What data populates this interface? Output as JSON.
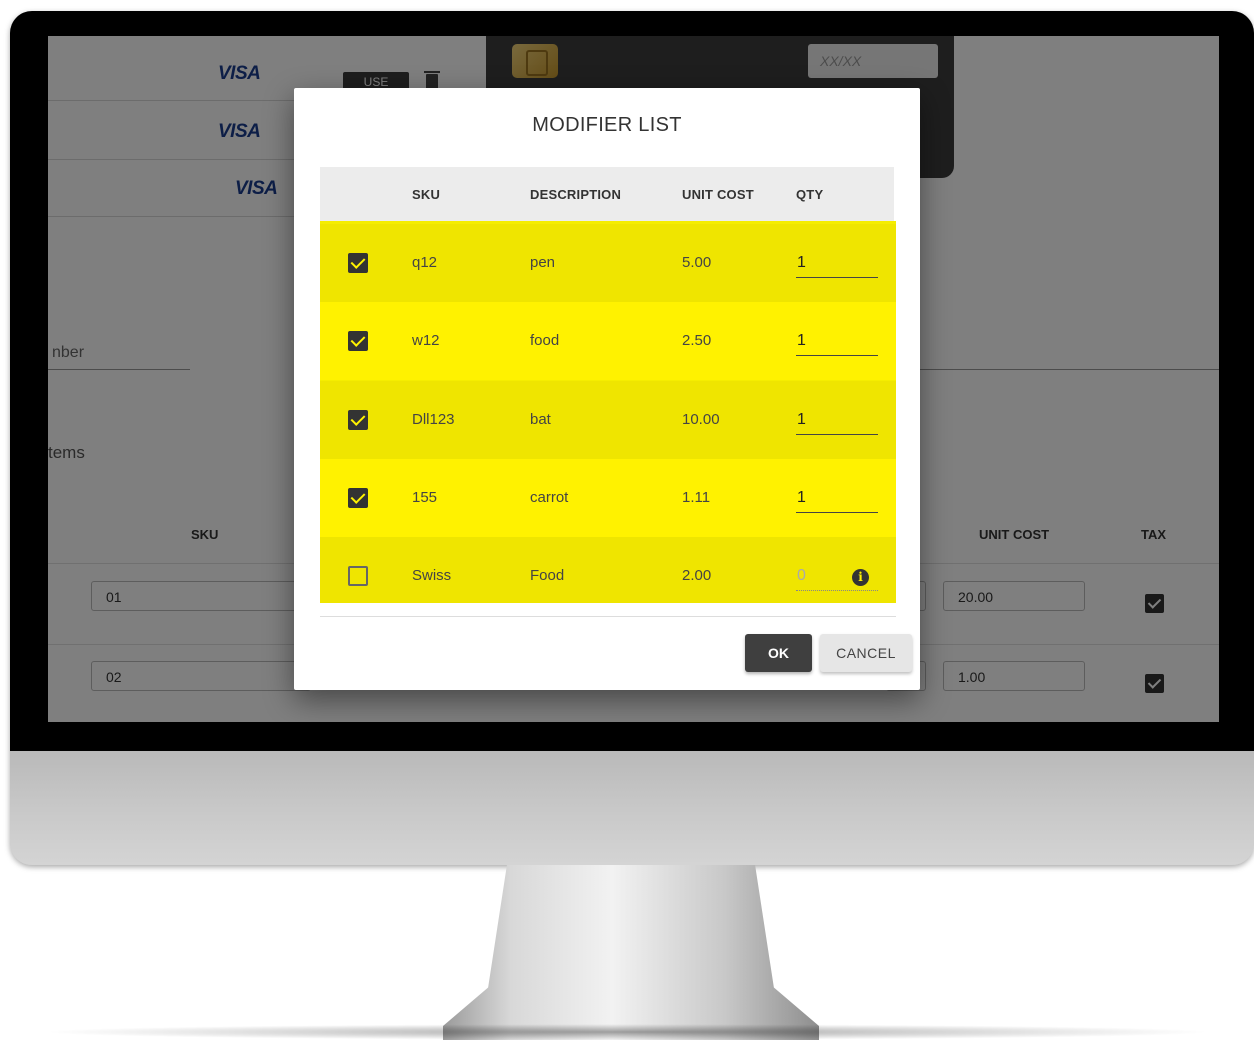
{
  "background": {
    "saved_cards": [
      {
        "brand": "VISA",
        "use_label": "USE"
      },
      {
        "brand": "VISA"
      },
      {
        "brand": "VISA"
      }
    ],
    "card_expiry_placeholder": "XX/XX",
    "number_field_label_fragment": "nber",
    "items_heading_fragment": "tems",
    "table_headers": {
      "sku": "SKU",
      "unit_cost": "UNIT COST",
      "tax": "TAX"
    },
    "rows": [
      {
        "sku": "01",
        "unit_cost": "20.00",
        "tax": true
      },
      {
        "sku": "02",
        "unit_cost": "1.00",
        "tax": true
      }
    ]
  },
  "dialog": {
    "title": "MODIFIER LIST",
    "columns": {
      "sku": "SKU",
      "description": "DESCRIPTION",
      "unit_cost": "UNIT COST",
      "qty": "QTY"
    },
    "rows": [
      {
        "checked": true,
        "sku": "q12",
        "description": "pen",
        "unit_cost": "5.00",
        "qty": "1"
      },
      {
        "checked": true,
        "sku": "w12",
        "description": "food",
        "unit_cost": "2.50",
        "qty": "1"
      },
      {
        "checked": true,
        "sku": "Dll123",
        "description": "bat",
        "unit_cost": "10.00",
        "qty": "1"
      },
      {
        "checked": true,
        "sku": "155",
        "description": "carrot",
        "unit_cost": "1.11",
        "qty": "1"
      },
      {
        "checked": false,
        "sku": "Swiss",
        "description": "Food",
        "unit_cost": "2.00",
        "qty": "0",
        "icon": "info-icon"
      }
    ],
    "ok_label": "OK",
    "cancel_label": "CANCEL"
  },
  "colors": {
    "highlight": "#fff200",
    "overlay": "rgba(0,0,0,0.5)",
    "primary_button": "#3f3f3f"
  }
}
